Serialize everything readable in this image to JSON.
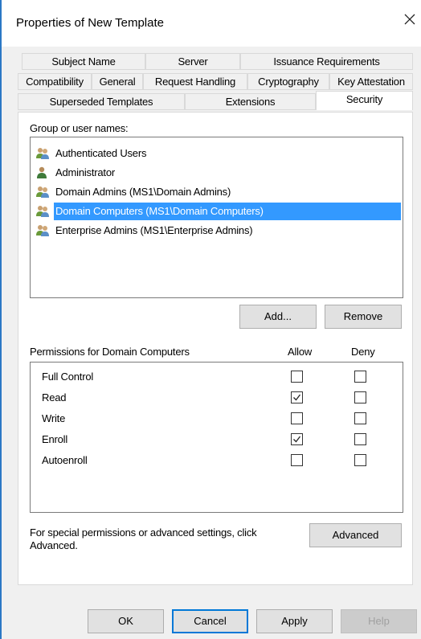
{
  "window": {
    "title": "Properties of New Template"
  },
  "tabs_row1": [
    "Subject Name",
    "Server",
    "Issuance Requirements"
  ],
  "tabs_row2": [
    "Compatibility",
    "General",
    "Request Handling",
    "Cryptography",
    "Key Attestation"
  ],
  "tabs_row3": [
    "Superseded Templates",
    "Extensions",
    "Security"
  ],
  "active_tab": "Security",
  "security": {
    "group_label": "Group or user names:",
    "users": [
      {
        "name": "Authenticated Users",
        "icon": "group-icon",
        "selected": false
      },
      {
        "name": "Administrator",
        "icon": "user-icon",
        "selected": false
      },
      {
        "name": "Domain Admins (MS1\\Domain Admins)",
        "icon": "group-icon",
        "selected": false
      },
      {
        "name": "Domain Computers (MS1\\Domain Computers)",
        "icon": "group-icon",
        "selected": true
      },
      {
        "name": "Enterprise Admins (MS1\\Enterprise Admins)",
        "icon": "group-icon",
        "selected": false
      }
    ],
    "add_label": "Add...",
    "remove_label": "Remove",
    "permissions_label": "Permissions for Domain Computers",
    "allow_label": "Allow",
    "deny_label": "Deny",
    "permissions": [
      {
        "name": "Full Control",
        "allow": false,
        "deny": false
      },
      {
        "name": "Read",
        "allow": true,
        "deny": false
      },
      {
        "name": "Write",
        "allow": false,
        "deny": false
      },
      {
        "name": "Enroll",
        "allow": true,
        "deny": false
      },
      {
        "name": "Autoenroll",
        "allow": false,
        "deny": false
      }
    ],
    "advanced_text_line1": "For special permissions or advanced settings, click",
    "advanced_text_line2": "Advanced.",
    "advanced_label": "Advanced"
  },
  "footer": {
    "ok": "OK",
    "cancel": "Cancel",
    "apply": "Apply",
    "help": "Help"
  },
  "colors": {
    "selection": "#3399ff",
    "default_button_border": "#0078d7",
    "window_edge": "#2b78c5"
  }
}
